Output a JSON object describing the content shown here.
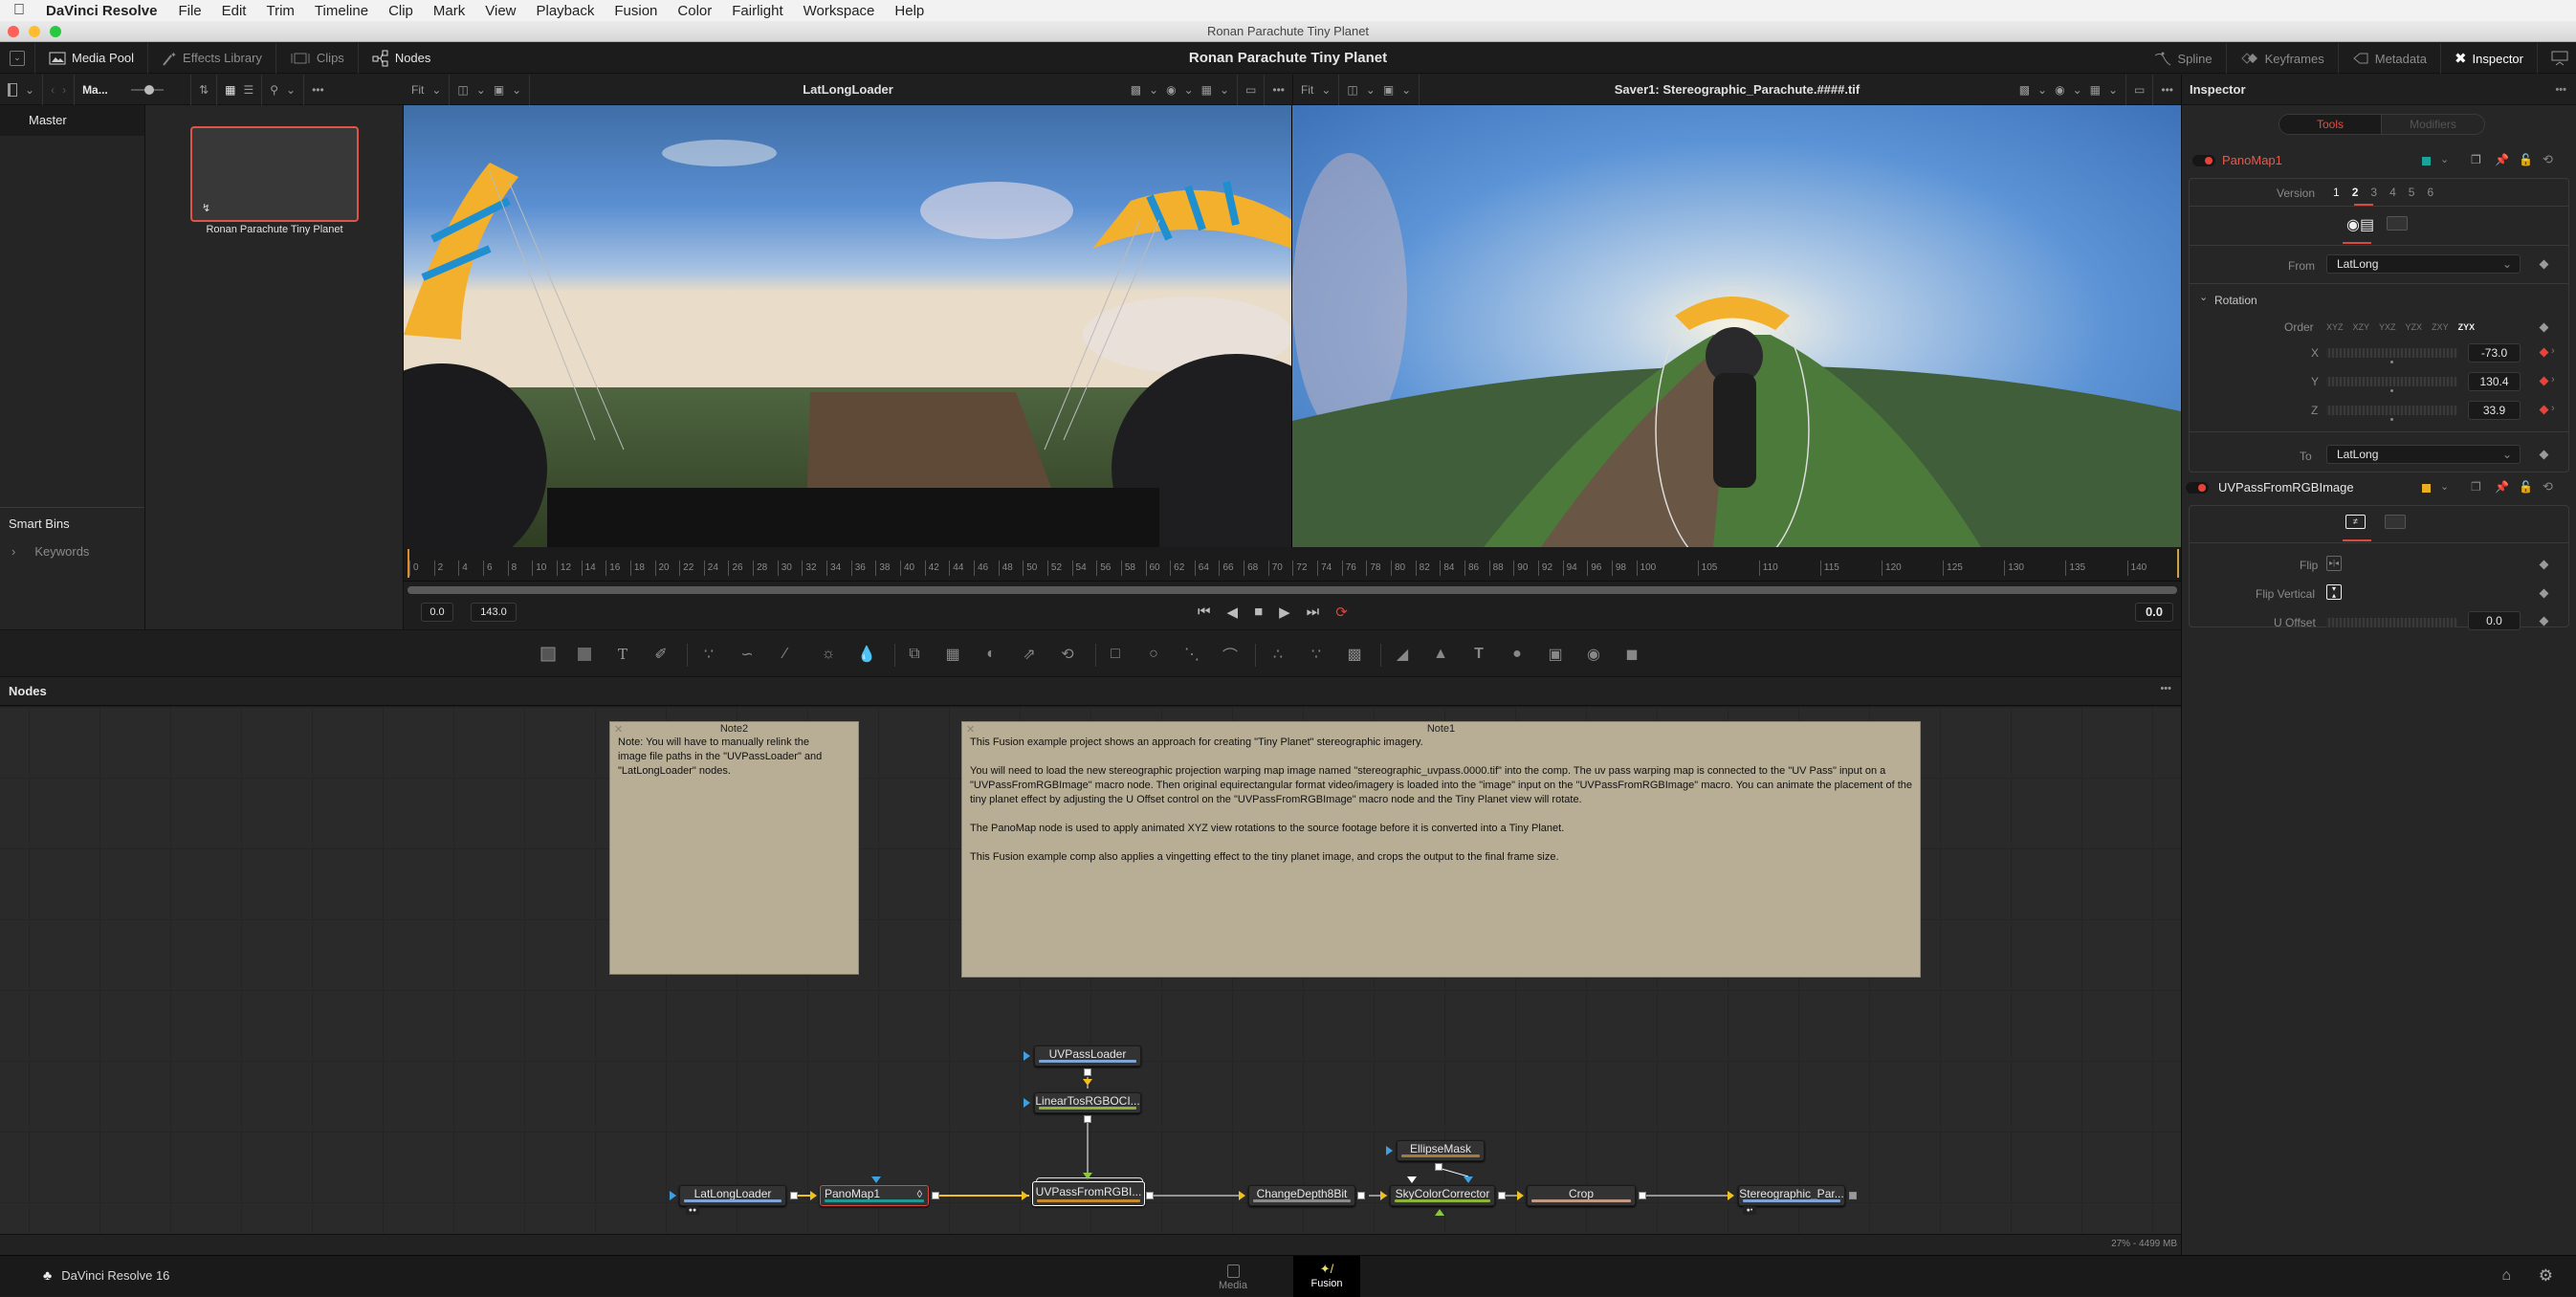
{
  "menubar": {
    "app_name": "DaVinci Resolve",
    "items": [
      "File",
      "Edit",
      "Trim",
      "Timeline",
      "Clip",
      "Mark",
      "View",
      "Playback",
      "Fusion",
      "Color",
      "Fairlight",
      "Workspace",
      "Help"
    ]
  },
  "window": {
    "title": "Ronan Parachute Tiny Planet"
  },
  "toolbar": {
    "project_title": "Ronan Parachute Tiny Planet",
    "left": [
      {
        "label": "Media Pool",
        "icon": "media-pool-icon",
        "active": true
      },
      {
        "label": "Effects Library",
        "icon": "effects-wand-icon",
        "active": false
      },
      {
        "label": "Clips",
        "icon": "clips-icon",
        "active": false
      },
      {
        "label": "Nodes",
        "icon": "nodes-icon",
        "active": true
      }
    ],
    "right": [
      {
        "label": "Spline",
        "icon": "spline-icon",
        "active": false
      },
      {
        "label": "Keyframes",
        "icon": "keyframes-icon",
        "active": false
      },
      {
        "label": "Metadata",
        "icon": "metadata-tag-icon",
        "active": false
      },
      {
        "label": "Inspector",
        "icon": "inspector-tools-icon",
        "active": true
      }
    ]
  },
  "media_pool": {
    "bin_label": "Ma...",
    "master_label": "Master",
    "clip_name": "Ronan Parachute Tiny Planet",
    "smart_bins_label": "Smart Bins",
    "keywords_label": "Keywords"
  },
  "viewers": {
    "left": {
      "fit": "Fit",
      "title": "LatLongLoader"
    },
    "right": {
      "fit": "Fit",
      "title": "Saver1: Stereographic_Parachute.####.tif"
    }
  },
  "timeline": {
    "ticks": [
      "0",
      "2",
      "4",
      "6",
      "8",
      "10",
      "12",
      "14",
      "16",
      "18",
      "20",
      "22",
      "24",
      "26",
      "28",
      "30",
      "32",
      "34",
      "36",
      "38",
      "40",
      "42",
      "44",
      "46",
      "48",
      "50",
      "52",
      "54",
      "56",
      "58",
      "60",
      "62",
      "64",
      "66",
      "68",
      "70",
      "72",
      "74",
      "76",
      "78",
      "80",
      "82",
      "84",
      "86",
      "88",
      "90",
      "92",
      "94",
      "96",
      "98",
      "100",
      "105",
      "110",
      "115",
      "120",
      "125",
      "130",
      "135",
      "140"
    ],
    "start_frame": "0.0",
    "end_frame": "143.0",
    "current_frame": "0.0",
    "playhead_fraction": 0.0
  },
  "nodes_panel": {
    "title": "Nodes",
    "notes": [
      {
        "title": "Note2",
        "lines": [
          "Note: You will have to manually relink the",
          "image file paths in the \"UVPassLoader\" and",
          "\"LatLongLoader\" nodes."
        ]
      },
      {
        "title": "Note1",
        "paragraphs": [
          "This Fusion example project shows an approach for creating \"Tiny Planet\" stereographic imagery.",
          "You will need to load the new stereographic projection warping map image named \"stereographic_uvpass.0000.tif\" into the comp. The uv pass warping map is connected to the \"UV Pass\" input on a \"UVPassFromRGBImage\" macro node. Then original equirectangular format video/imagery is loaded into the \"image\" input on the \"UVPassFromRGBImage\" macro. You can animate the placement of the tiny planet effect by adjusting the U Offset control on the \"UVPassFromRGBImage\" macro node and the Tiny Planet view will rotate.",
          "The PanoMap node is used to apply animated XYZ view rotations to the source footage before it is converted into a Tiny Planet.",
          "This Fusion example comp also applies a vingetting effect to the tiny planet image, and crops the output to the final frame size."
        ]
      }
    ],
    "nodes": [
      {
        "id": "uvpassloader",
        "label": "UVPassLoader",
        "color": "#7fa3d4"
      },
      {
        "id": "lineartosrgb",
        "label": "LinearTosRGBOCI...",
        "color": "#8cb43a"
      },
      {
        "id": "latlongloader",
        "label": "LatLongLoader",
        "color": "#7fa3d4"
      },
      {
        "id": "panomap1",
        "label": "PanoMap1",
        "color": "#1f9a93",
        "selected": true
      },
      {
        "id": "uvpassfromrgb",
        "label": "UVPassFromRGBI...",
        "color": "#c68a2e",
        "group": true
      },
      {
        "id": "changedepth",
        "label": "ChangeDepth8Bit",
        "color": "#8a8a8a"
      },
      {
        "id": "ellipsemask",
        "label": "EllipseMask",
        "color": "#a57a3a"
      },
      {
        "id": "skycolor",
        "label": "SkyColorCorrector",
        "color": "#8cb43a"
      },
      {
        "id": "crop",
        "label": "Crop",
        "color": "#c09a84"
      },
      {
        "id": "saver",
        "label": "Stereographic_Par...",
        "color": "#7fa3d4"
      }
    ]
  },
  "statusbar": {
    "memory": "27% - 4499 MB"
  },
  "pagebar": {
    "brand": "DaVinci Resolve 16",
    "pages": [
      {
        "label": "Media",
        "active": false
      },
      {
        "label": "Fusion",
        "active": true
      }
    ]
  },
  "inspector": {
    "title": "Inspector",
    "tabs": [
      {
        "label": "Tools",
        "active": true
      },
      {
        "label": "Modifiers",
        "active": false
      }
    ],
    "tools": [
      {
        "name": "PanoMap1",
        "swatch": "#1aa39b",
        "versions": [
          "1",
          "2",
          "3",
          "4",
          "5",
          "6"
        ],
        "active_version": "2",
        "from_label": "From",
        "from_value": "LatLong",
        "section": "Rotation",
        "order_label": "Order",
        "orders": [
          "XYZ",
          "XZY",
          "YXZ",
          "YZX",
          "ZXY",
          "ZYX"
        ],
        "active_order": "ZYX",
        "rotation": [
          {
            "axis": "X",
            "value": "-73.0"
          },
          {
            "axis": "Y",
            "value": "130.4"
          },
          {
            "axis": "Z",
            "value": "33.9"
          }
        ],
        "to_label": "To",
        "to_value": "LatLong"
      },
      {
        "name": "UVPassFromRGBImage",
        "swatch": "#e8b021",
        "flip_label": "Flip",
        "flip_vertical_label": "Flip Vertical",
        "u_offset_label": "U Offset",
        "u_offset_value": "0.0"
      }
    ]
  }
}
